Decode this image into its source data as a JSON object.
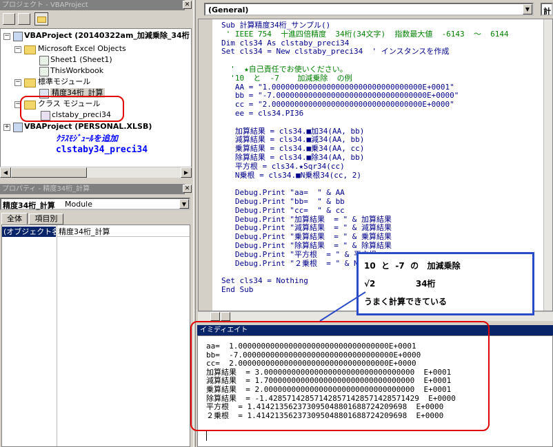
{
  "project_panel": {
    "title": "プロジェクト - VBAProject",
    "toolbar": [
      "view-code-icon",
      "view-object-icon",
      "toggle-folders-icon"
    ],
    "tree": [
      {
        "label": "VBAProject (20140322am_加減乗除_34桁",
        "level": 0,
        "bold": true
      },
      {
        "label": "Microsoft Excel Objects",
        "level": 1
      },
      {
        "label": "Sheet1 (Sheet1)",
        "level": 2
      },
      {
        "label": "ThisWorkbook",
        "level": 2
      },
      {
        "label": "標準モジュール",
        "level": 1
      },
      {
        "label": "精度34桁_計算",
        "level": 2
      },
      {
        "label": "クラス モジュール",
        "level": 1
      },
      {
        "label": "clstaby_preci34",
        "level": 2
      },
      {
        "label": "VBAProject (PERSONAL.XLSB)",
        "level": 0,
        "bold": true
      }
    ],
    "annotation_line1": "ｸﾗｽﾓｼﾞｭｰﾙを追加",
    "annotation_line2": "clstaby34_preci34"
  },
  "properties_panel": {
    "title": "プロパティ - 精度34桁_計算",
    "object_name": "精度34桁_計算",
    "object_type": "Module",
    "tabs": [
      "全体",
      "項目別"
    ],
    "prop_name": "(オブジェクト名)",
    "prop_value": "精度34桁_計算"
  },
  "code_window": {
    "object_dropdown": "(General)",
    "proc_dropdown": "計",
    "lines": [
      {
        "text": "Sub 計算精度34桁_サンプル()",
        "cls": "kw"
      },
      {
        "text": " ' IEEE 754  十進四倍精度  34桁(34文字)  指数最大値  -6143  ～  6144",
        "cls": "cm"
      },
      {
        "text": "Dim cls34 As clstaby_preci34",
        "cls": "kw"
      },
      {
        "text": "Set cls34 = New clstaby_preci34  ' インスタンスを作成",
        "cls": "kw"
      },
      {
        "text": "",
        "cls": ""
      },
      {
        "text": "  '  ★自己責任でお使いください。",
        "cls": "cm"
      },
      {
        "text": "  '10  と  -7    加減乗除  の例",
        "cls": "cm"
      },
      {
        "text": "   AA = \"1.000000000000000000000000000000000E+0001\"",
        "cls": "kw"
      },
      {
        "text": "   bb = \"-7.000000000000000000000000000000000E+0000\"",
        "cls": "kw"
      },
      {
        "text": "   cc = \"2.000000000000000000000000000000000E+0000\"",
        "cls": "kw"
      },
      {
        "text": "   ee = cls34.PI36",
        "cls": "kw"
      },
      {
        "text": "",
        "cls": ""
      },
      {
        "text": "   加算結果 = cls34.■加34(AA, bb)",
        "cls": "kw"
      },
      {
        "text": "   減算結果 = cls34.■減34(AA, bb)",
        "cls": "kw"
      },
      {
        "text": "   乗算結果 = cls34.■乗34(AA, cc)",
        "cls": "kw"
      },
      {
        "text": "   除算結果 = cls34.■除34(AA, bb)",
        "cls": "kw"
      },
      {
        "text": "   平方根 = cls34.★Sqr34(cc)",
        "cls": "kw"
      },
      {
        "text": "   N乗根 = cls34.■N乗根34(cc, 2)",
        "cls": "kw"
      },
      {
        "text": "",
        "cls": ""
      },
      {
        "text": "   Debug.Print \"aa=  \" & AA",
        "cls": "kw"
      },
      {
        "text": "   Debug.Print \"bb=  \" & bb",
        "cls": "kw"
      },
      {
        "text": "   Debug.Print \"cc=  \" & cc",
        "cls": "kw"
      },
      {
        "text": "   Debug.Print \"加算結果  = \" & 加算結果",
        "cls": "kw"
      },
      {
        "text": "   Debug.Print \"減算結果  = \" & 減算結果",
        "cls": "kw"
      },
      {
        "text": "   Debug.Print \"乗算結果  = \" & 乗算結果",
        "cls": "kw"
      },
      {
        "text": "   Debug.Print \"除算結果  = \" & 除算結果",
        "cls": "kw"
      },
      {
        "text": "   Debug.Print \"平方根  = \" & 平方根",
        "cls": "kw"
      },
      {
        "text": "   Debug.Print \"２乗根  = \" & N乗根",
        "cls": "kw"
      },
      {
        "text": "",
        "cls": ""
      },
      {
        "text": "Set cls34 = Nothing",
        "cls": "kw"
      },
      {
        "text": "End Sub",
        "cls": "kw"
      }
    ]
  },
  "callout": {
    "line1": "10  と  -7  の   加減乗除",
    "line2": "√2              34桁",
    "line3": "うまく計算できている"
  },
  "immediate_window": {
    "title": "イミディエイト",
    "lines": [
      "aa=  1.000000000000000000000000000000000E+0001",
      "bb=  -7.000000000000000000000000000000000E+0000",
      "cc=  2.000000000000000000000000000000000E+0000",
      "加算結果  = 3.000000000000000000000000000000000  E+0001",
      "減算結果  = 1.700000000000000000000000000000000  E+0001",
      "乗算結果  = 2.000000000000000000000000000000000  E+0001",
      "除算結果  = -1.428571428571428571428571428571429  E+0000",
      "平方根  = 1.414213562373095048801688724209698  E+0000",
      "２乗根  = 1.414213562373095048801688724209698  E+0000"
    ]
  },
  "colors": {
    "annotation": "#0000ff",
    "highlight_box": "#e00000",
    "callout_border": "#2a4bc8",
    "title_active": "#0a246a"
  }
}
